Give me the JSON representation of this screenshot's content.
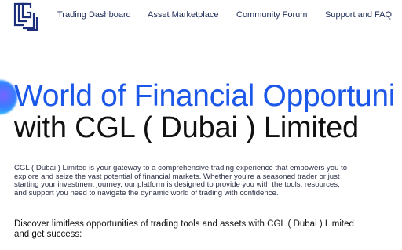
{
  "nav": {
    "items": [
      {
        "label": "Trading Dashboard"
      },
      {
        "label": "Asset Marketplace"
      },
      {
        "label": "Community Forum"
      },
      {
        "label": "Support and FAQ"
      }
    ]
  },
  "hero": {
    "headline_line1": "World of Financial Opportuni",
    "headline_line2": "with CGL ( Dubai ) Limited",
    "intro": "CGL ( Dubai ) Limited is your gateway to a comprehensive trading experience that empowers you to explore and seize the vast potential of financial markets. Whether you're a seasoned trader or just starting your investment journey, our platform is designed to provide you with the tools, resources, and support you need to navigate the dynamic world of trading with confidence.",
    "discover": "Discover limitless opportunities of trading tools and assets with CGL ( Dubai ) Limited and get success:"
  },
  "colors": {
    "accent": "#1b57e8",
    "nav_text": "#1c2a55",
    "logo": "#1e2f7a"
  }
}
